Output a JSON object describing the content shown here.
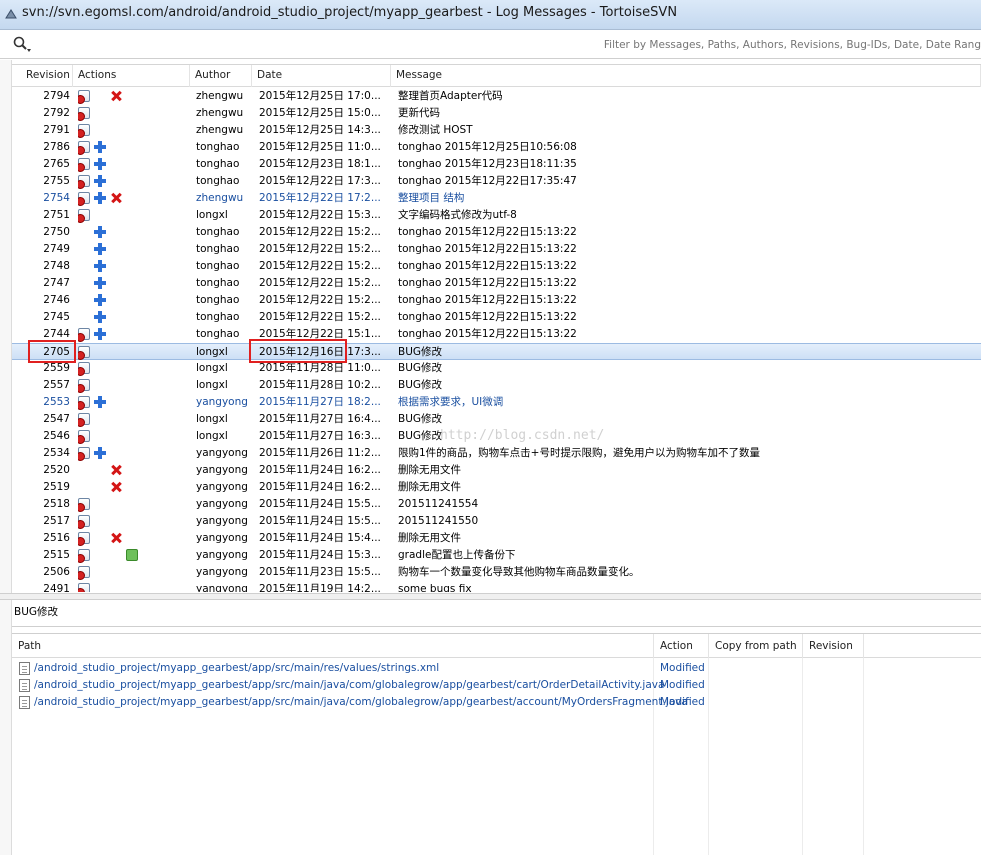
{
  "window": {
    "title": "svn://svn.egomsl.com/android/android_studio_project/myapp_gearbest - Log Messages - TortoiseSVN"
  },
  "filter": {
    "placeholder": "Filter by Messages, Paths, Authors, Revisions, Bug-IDs, Date, Date Rang"
  },
  "log": {
    "columns": {
      "revision": "Revision",
      "actions": "Actions",
      "author": "Author",
      "date": "Date",
      "message": "Message"
    },
    "rows": [
      {
        "rev": "2794",
        "actions": [
          "modified",
          "deleted"
        ],
        "author": "zhengwu",
        "date": "2015年12月25日 17:0...",
        "msg": "整理首页Adapter代码",
        "style": ""
      },
      {
        "rev": "2792",
        "actions": [
          "modified"
        ],
        "author": "zhengwu",
        "date": "2015年12月25日 15:0...",
        "msg": "更新代码",
        "style": ""
      },
      {
        "rev": "2791",
        "actions": [
          "modified"
        ],
        "author": "zhengwu",
        "date": "2015年12月25日 14:3...",
        "msg": "修改测试 HOST",
        "style": ""
      },
      {
        "rev": "2786",
        "actions": [
          "modified",
          "added"
        ],
        "author": "tonghao",
        "date": "2015年12月25日 11:0...",
        "msg": "tonghao 2015年12月25日10:56:08",
        "style": ""
      },
      {
        "rev": "2765",
        "actions": [
          "modified",
          "added"
        ],
        "author": "tonghao",
        "date": "2015年12月23日 18:1...",
        "msg": "tonghao 2015年12月23日18:11:35",
        "style": ""
      },
      {
        "rev": "2755",
        "actions": [
          "modified",
          "added"
        ],
        "author": "tonghao",
        "date": "2015年12月22日 17:3...",
        "msg": "tonghao 2015年12月22日17:35:47",
        "style": ""
      },
      {
        "rev": "2754",
        "actions": [
          "modified",
          "added",
          "deleted"
        ],
        "author": "zhengwu",
        "date": "2015年12月22日 17:2...",
        "msg": "整理项目 结构",
        "style": "blue"
      },
      {
        "rev": "2751",
        "actions": [
          "modified"
        ],
        "author": "longxl",
        "date": "2015年12月22日 15:3...",
        "msg": "文字编码格式修改为utf-8",
        "style": ""
      },
      {
        "rev": "2750",
        "actions": [
          "added"
        ],
        "author": "tonghao",
        "date": "2015年12月22日 15:2...",
        "msg": "tonghao 2015年12月22日15:13:22",
        "style": ""
      },
      {
        "rev": "2749",
        "actions": [
          "added"
        ],
        "author": "tonghao",
        "date": "2015年12月22日 15:2...",
        "msg": "tonghao 2015年12月22日15:13:22",
        "style": ""
      },
      {
        "rev": "2748",
        "actions": [
          "added"
        ],
        "author": "tonghao",
        "date": "2015年12月22日 15:2...",
        "msg": "tonghao 2015年12月22日15:13:22",
        "style": ""
      },
      {
        "rev": "2747",
        "actions": [
          "added"
        ],
        "author": "tonghao",
        "date": "2015年12月22日 15:2...",
        "msg": "tonghao 2015年12月22日15:13:22",
        "style": ""
      },
      {
        "rev": "2746",
        "actions": [
          "added"
        ],
        "author": "tonghao",
        "date": "2015年12月22日 15:2...",
        "msg": "tonghao 2015年12月22日15:13:22",
        "style": ""
      },
      {
        "rev": "2745",
        "actions": [
          "added"
        ],
        "author": "tonghao",
        "date": "2015年12月22日 15:2...",
        "msg": "tonghao 2015年12月22日15:13:22",
        "style": ""
      },
      {
        "rev": "2744",
        "actions": [
          "modified",
          "added"
        ],
        "author": "tonghao",
        "date": "2015年12月22日 15:1...",
        "msg": "tonghao 2015年12月22日15:13:22",
        "style": ""
      },
      {
        "rev": "2705",
        "actions": [
          "modified"
        ],
        "author": "longxl",
        "date": "2015年12月16日 17:3...",
        "msg": "BUG修改",
        "style": "selected"
      },
      {
        "rev": "2559",
        "actions": [
          "modified"
        ],
        "author": "longxl",
        "date": "2015年11月28日 11:0...",
        "msg": "BUG修改",
        "style": ""
      },
      {
        "rev": "2557",
        "actions": [
          "modified"
        ],
        "author": "longxl",
        "date": "2015年11月28日 10:2...",
        "msg": "BUG修改",
        "style": ""
      },
      {
        "rev": "2553",
        "actions": [
          "modified",
          "added"
        ],
        "author": "yangyong",
        "date": "2015年11月27日 18:2...",
        "msg": "根据需求要求，UI微调",
        "style": "blue"
      },
      {
        "rev": "2547",
        "actions": [
          "modified"
        ],
        "author": "longxl",
        "date": "2015年11月27日 16:4...",
        "msg": "BUG修改",
        "style": ""
      },
      {
        "rev": "2546",
        "actions": [
          "modified"
        ],
        "author": "longxl",
        "date": "2015年11月27日 16:3...",
        "msg": "BUG修改",
        "style": ""
      },
      {
        "rev": "2534",
        "actions": [
          "modified",
          "added"
        ],
        "author": "yangyong",
        "date": "2015年11月26日 11:2...",
        "msg": "限购1件的商品，购物车点击+号时提示限购，避免用户以为购物车加不了数量",
        "style": ""
      },
      {
        "rev": "2520",
        "actions": [
          "deleted"
        ],
        "author": "yangyong",
        "date": "2015年11月24日 16:2...",
        "msg": "删除无用文件",
        "style": ""
      },
      {
        "rev": "2519",
        "actions": [
          "deleted"
        ],
        "author": "yangyong",
        "date": "2015年11月24日 16:2...",
        "msg": "删除无用文件",
        "style": ""
      },
      {
        "rev": "2518",
        "actions": [
          "modified"
        ],
        "author": "yangyong",
        "date": "2015年11月24日 15:5...",
        "msg": "201511241554",
        "style": ""
      },
      {
        "rev": "2517",
        "actions": [
          "modified"
        ],
        "author": "yangyong",
        "date": "2015年11月24日 15:5...",
        "msg": "201511241550",
        "style": ""
      },
      {
        "rev": "2516",
        "actions": [
          "modified",
          "deleted"
        ],
        "author": "yangyong",
        "date": "2015年11月24日 15:4...",
        "msg": "删除无用文件",
        "style": ""
      },
      {
        "rev": "2515",
        "actions": [
          "modified",
          "replaced"
        ],
        "author": "yangyong",
        "date": "2015年11月24日 15:3...",
        "msg": "gradle配置也上传备份下",
        "style": ""
      },
      {
        "rev": "2506",
        "actions": [
          "modified"
        ],
        "author": "yangyong",
        "date": "2015年11月23日 15:5...",
        "msg": "购物车一个数量变化导致其他购物车商品数量变化。",
        "style": ""
      },
      {
        "rev": "2491",
        "actions": [
          "modified"
        ],
        "author": "yangyong",
        "date": "2015年11月19日 14:2...",
        "msg": "some bugs fix",
        "style": ""
      }
    ]
  },
  "watermark": "http://blog.csdn.net/",
  "selected_message": "BUG修改",
  "paths": {
    "columns": {
      "path": "Path",
      "action": "Action",
      "copy_from": "Copy from path",
      "revision": "Revision"
    },
    "rows": [
      {
        "path": "/android_studio_project/myapp_gearbest/app/src/main/res/values/strings.xml",
        "action": "Modified"
      },
      {
        "path": "/android_studio_project/myapp_gearbest/app/src/main/java/com/globalegrow/app/gearbest/cart/OrderDetailActivity.java",
        "action": "Modified"
      },
      {
        "path": "/android_studio_project/myapp_gearbest/app/src/main/java/com/globalegrow/app/gearbest/account/MyOrdersFragment.java",
        "action": "Modified"
      }
    ]
  },
  "colors": {
    "highlight_box": "#e02020",
    "link_blue": "#1a4fa0",
    "selection": "#cde0f6"
  }
}
